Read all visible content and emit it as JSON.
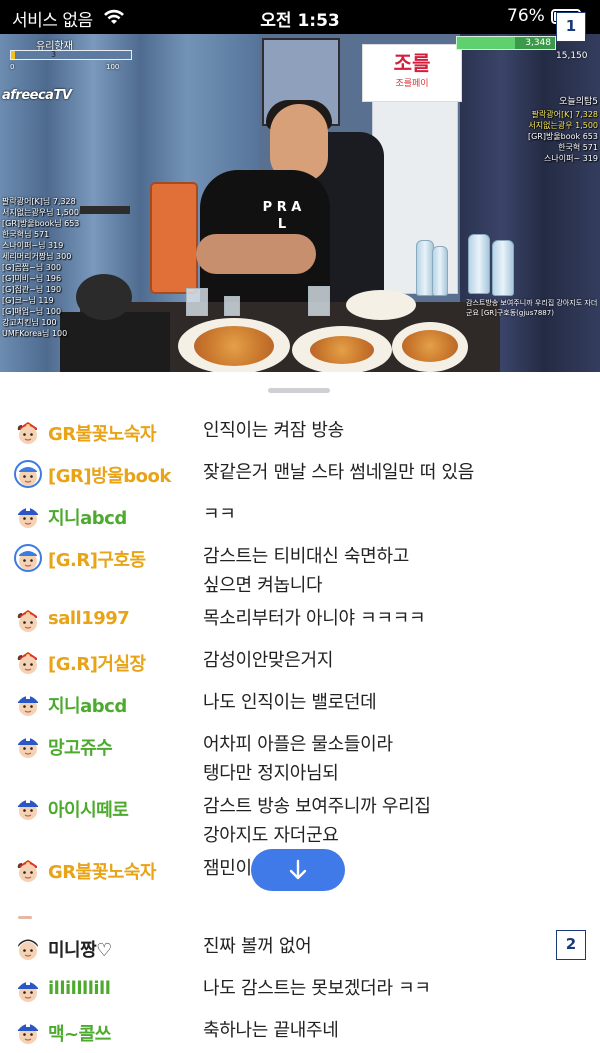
{
  "status_bar": {
    "carrier": "서비스 없음",
    "time": "오전 1:53",
    "battery_percent": "76%",
    "battery_level": 0.76,
    "wifi_icon": "wifi-icon",
    "battery_icon": "battery-icon"
  },
  "markers": {
    "one": "1",
    "two": "2"
  },
  "video": {
    "logo": "afreecaTV",
    "top_bar_label": "유리항재",
    "top_bar_value": "3",
    "top_bar_min": "0",
    "top_bar_max": "100",
    "goal_value": "3,348",
    "goal_total": "15,150",
    "sign_small": "조를페이",
    "sign_big": "조를",
    "shirt_text": "P R A L",
    "left_ranking": [
      "팔락광어[K]님 7,328",
      "서지없는광우님 1,500",
      "[GR]방울book님 653",
      "한국혁님 571",
      "스나이퍼~님 319",
      "세리머리거짱님 300",
      "[G]곰쩝~님 300",
      "[G]미비~님 196",
      "[G]집관~님 190",
      "[G]크~님 119",
      "[G]매업~님 100",
      "강고치킨님 100",
      "UMFKorea님 100"
    ],
    "right_ranking_title": "오늘의탑5",
    "right_ranking": [
      "팔락광어[K] 7,328",
      "서지없는광우 1,500",
      "[GR]방울book 653",
      "한국혁 571",
      "스나이퍼~ 319"
    ],
    "donor_text": "감스트방송 보여주니까 우리집 강아지도 자더군요 [GR]구호동(gjus7887)"
  },
  "chat": {
    "colors": {
      "gold": "#e8a317",
      "green": "#4daa2e",
      "blue": "#3d7be0",
      "gray": "#222222"
    },
    "messages": [
      {
        "nick": "GR불꽃노숙자",
        "text": "인직이는 켜잠 방송",
        "nick_color": "#e8a317",
        "avatar": "fire-rank-avatar-icon"
      },
      {
        "nick": "[GR]방울book",
        "text": "잦같은거 맨날 스타 썸네일만 떠 있음",
        "nick_color": "#e8a317",
        "avatar": "manager-avatar-icon"
      },
      {
        "nick": "지니abcd",
        "text": "ㅋㅋ",
        "nick_color": "#4daa2e",
        "avatar": "fan-avatar-icon"
      },
      {
        "nick": "[G.R]구호동",
        "text": "감스트는 티비대신 숙면하고",
        "text2": "싶으면 켜놉니다",
        "nick_color": "#e8a317",
        "avatar": "manager-avatar-icon"
      },
      {
        "nick": "sall1997",
        "text": "목소리부터가 아니야 ㅋㅋㅋㅋ",
        "nick_color": "#e8a317",
        "avatar": "fire-rank-avatar-icon"
      },
      {
        "nick": "[G.R]거실장",
        "text": "감성이안맞은거지",
        "nick_color": "#e8a317",
        "avatar": "fire-rank-avatar-icon"
      },
      {
        "nick": "지니abcd",
        "text": "나도 인직이는 밸로던데",
        "nick_color": "#4daa2e",
        "avatar": "fan-avatar-icon"
      },
      {
        "nick": "망고쥬수",
        "text": "어차피 아플은 물소들이라",
        "text2": "탱다만 정지아님되",
        "nick_color": "#4daa2e",
        "avatar": "fan-avatar-icon"
      },
      {
        "nick": "아이시떼로",
        "text": "감스트 방송 보여주니까 우리집",
        "text2": "강아지도 자더군요",
        "nick_color": "#4daa2e",
        "avatar": "fan-avatar-icon"
      },
      {
        "nick": "GR불꽃노숙자",
        "text": "잼민이",
        "nick_color": "#e8a317",
        "avatar": "fire-rank-avatar-icon"
      },
      {
        "nick": "미니짱♡",
        "text": "진짜 볼꺼 없어",
        "nick_color": "#222222",
        "avatar": "viewer-avatar-icon"
      },
      {
        "nick": "illillllill",
        "text": "나도 감스트는 못보겠더라 ㅋㅋ",
        "nick_color": "#4daa2e",
        "avatar": "fan-avatar-icon"
      },
      {
        "nick": "맥~콜쓰",
        "text": "축하나는 끝내주네",
        "nick_color": "#4daa2e",
        "avatar": "fan-avatar-icon"
      }
    ],
    "scroll_button_icon": "arrow-down-icon"
  }
}
